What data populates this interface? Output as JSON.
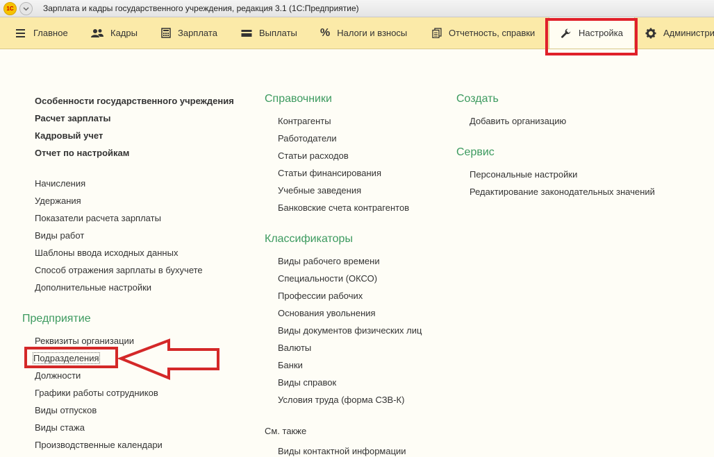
{
  "window": {
    "title": "Зарплата и кадры государственного учреждения, редакция 3.1  (1С:Предприятие)",
    "logo_text": "1С"
  },
  "sections": [
    {
      "label": "Главное",
      "icon": "hamburger-icon"
    },
    {
      "label": "Кадры",
      "icon": "people-icon"
    },
    {
      "label": "Зарплата",
      "icon": "calculator-icon"
    },
    {
      "label": "Выплаты",
      "icon": "wallet-icon"
    },
    {
      "label": "Налоги и взносы",
      "icon": "percent-icon"
    },
    {
      "label": "Отчетность, справки",
      "icon": "documents-icon"
    },
    {
      "label": "Настройка",
      "icon": "wrench-icon",
      "active": true
    },
    {
      "label": "Администри",
      "icon": "gear-icon"
    }
  ],
  "left": {
    "bold_links": [
      "Особенности государственного учреждения",
      "Расчет зарплаты",
      "Кадровый учет",
      "Отчет по настройкам"
    ],
    "links": [
      "Начисления",
      "Удержания",
      "Показатели расчета зарплаты",
      "Виды работ",
      "Шаблоны ввода исходных данных",
      "Способ отражения зарплаты в бухучете",
      "Дополнительные настройки"
    ],
    "group_title": "Предприятие",
    "group_links": [
      "Реквизиты организации",
      "Подразделения",
      "Должности",
      "Графики работы сотрудников",
      "Виды отпусков",
      "Виды стажа",
      "Производственные календари"
    ]
  },
  "middle": {
    "directories_title": "Справочники",
    "directories": [
      "Контрагенты",
      "Работодатели",
      "Статьи расходов",
      "Статьи финансирования",
      "Учебные заведения",
      "Банковские счета контрагентов"
    ],
    "classifiers_title": "Классификаторы",
    "classifiers": [
      "Виды рабочего времени",
      "Специальности (ОКСО)",
      "Профессии рабочих",
      "Основания увольнения",
      "Виды документов физических лиц",
      "Валюты",
      "Банки",
      "Виды справок",
      "Условия труда (форма СЗВ-К)"
    ],
    "see_also_title": "См. также",
    "see_also": [
      "Виды контактной информации"
    ]
  },
  "right": {
    "create_title": "Создать",
    "create": [
      "Добавить организацию"
    ],
    "service_title": "Сервис",
    "service": [
      "Персональные настройки",
      "Редактирование законодательных значений"
    ]
  },
  "colors": {
    "panel_bg": "#fbeaa8",
    "group_title": "#3c9a5f",
    "highlight": "#e0202a"
  }
}
